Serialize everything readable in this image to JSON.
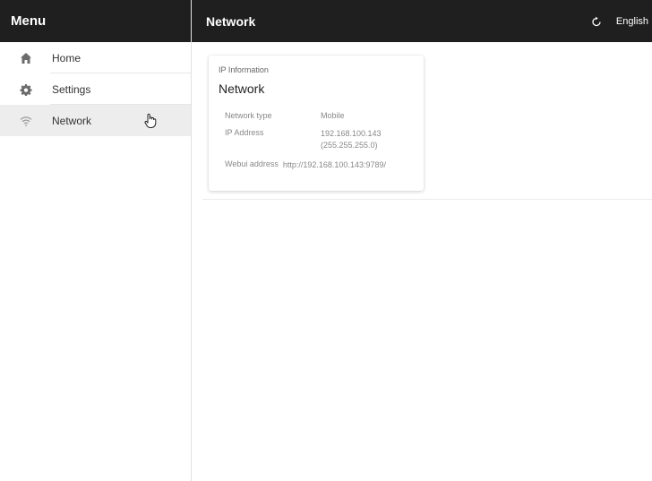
{
  "sidebar": {
    "title": "Menu",
    "items": [
      {
        "label": "Home",
        "icon": "home-icon"
      },
      {
        "label": "Settings",
        "icon": "gear-icon"
      },
      {
        "label": "Network",
        "icon": "wifi-icon",
        "active": true
      }
    ]
  },
  "topbar": {
    "title": "Network",
    "language": "English",
    "refresh_icon": "refresh-icon"
  },
  "card": {
    "overline": "IP Information",
    "title": "Network",
    "rows": [
      {
        "key": "Network type",
        "value": "Mobile"
      },
      {
        "key": "IP Address",
        "value": "192.168.100.143",
        "value2": "(255.255.255.0)"
      },
      {
        "key": "Webui address",
        "value": "http://192.168.100.143:9789/"
      }
    ]
  },
  "colors": {
    "header_bg": "#1f1f1f",
    "active_item_bg": "#ededed",
    "text": "#333333"
  }
}
